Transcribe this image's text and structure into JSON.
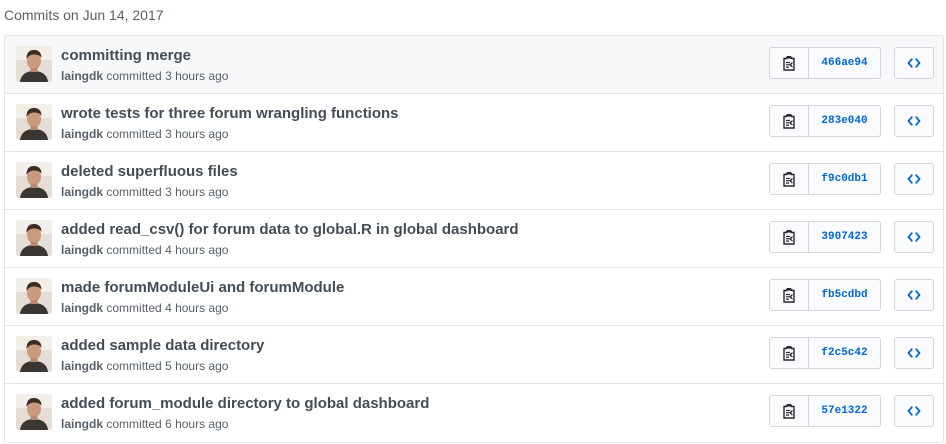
{
  "group_title": "Commits on Jun 14, 2017",
  "icons": {
    "avatar": "avatar-photo",
    "copy": "clippy-icon",
    "browse": "code-icon"
  },
  "colors": {
    "sha_link": "#0366d6",
    "title_text": "#444d56",
    "meta_text": "#586069",
    "border": "#e1e4e8"
  },
  "commits": [
    {
      "title": "committing merge",
      "author": "laingdk",
      "verb": "committed",
      "time": "3 hours ago",
      "sha": "466ae94"
    },
    {
      "title": "wrote tests for three forum wrangling functions",
      "author": "laingdk",
      "verb": "committed",
      "time": "3 hours ago",
      "sha": "283e040"
    },
    {
      "title": "deleted superfluous files",
      "author": "laingdk",
      "verb": "committed",
      "time": "3 hours ago",
      "sha": "f9c0db1"
    },
    {
      "title": "added read_csv() for forum data to global.R in global dashboard",
      "author": "laingdk",
      "verb": "committed",
      "time": "4 hours ago",
      "sha": "3907423"
    },
    {
      "title": "made forumModuleUi and forumModule",
      "author": "laingdk",
      "verb": "committed",
      "time": "4 hours ago",
      "sha": "fb5cdbd"
    },
    {
      "title": "added sample data directory",
      "author": "laingdk",
      "verb": "committed",
      "time": "5 hours ago",
      "sha": "f2c5c42"
    },
    {
      "title": "added forum_module directory to global dashboard",
      "author": "laingdk",
      "verb": "committed",
      "time": "6 hours ago",
      "sha": "57e1322"
    }
  ]
}
